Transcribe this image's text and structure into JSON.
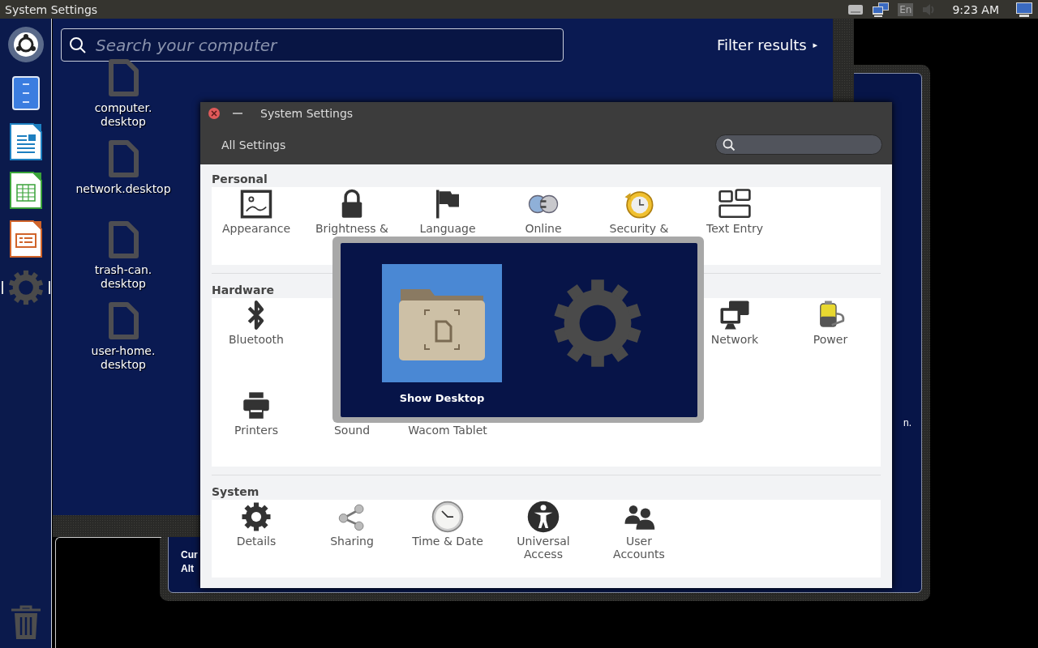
{
  "top_panel": {
    "title": "System Settings",
    "language": "En",
    "clock": "9:23 AM"
  },
  "launcher": {
    "items": [
      {
        "kind": "ubuntu",
        "running": false
      },
      {
        "kind": "files",
        "running": false
      },
      {
        "kind": "writer",
        "running": false
      },
      {
        "kind": "calc",
        "running": false
      },
      {
        "kind": "impress",
        "running": false
      },
      {
        "kind": "settings",
        "running": true
      },
      {
        "kind": "trash",
        "running": false
      }
    ]
  },
  "dash": {
    "search": {
      "placeholder": "Search your computer"
    },
    "filter": {
      "label": "Filter results",
      "arrow": "▸"
    }
  },
  "desktop_icons": [
    {
      "label": "computer. desktop"
    },
    {
      "label": "network.desktop"
    },
    {
      "label": "trash-can. desktop"
    },
    {
      "label": "user-home. desktop"
    }
  ],
  "background_window": {
    "left_texts": [
      "Cur",
      "Alt"
    ],
    "right_text": "n."
  },
  "settings_window": {
    "title": "System Settings",
    "toolbar": {
      "button": "All Settings"
    },
    "sections": [
      {
        "title": "Personal",
        "items": [
          {
            "kind": "setting",
            "label": "Appearance"
          },
          {
            "kind": "setting",
            "label": "Brightness &"
          },
          {
            "kind": "setting",
            "label": "Language"
          },
          {
            "kind": "setting",
            "label": "Online"
          },
          {
            "kind": "setting",
            "label": "Security &"
          },
          {
            "kind": "setting",
            "label": "Text Entry"
          }
        ]
      },
      {
        "title": "Hardware",
        "items": [
          {
            "kind": "setting",
            "label": "Bluetooth"
          },
          {
            "kind": "covered"
          },
          {
            "kind": "covered"
          },
          {
            "kind": "covered"
          },
          {
            "kind": "covered"
          },
          {
            "kind": "setting",
            "label": "Network"
          },
          {
            "kind": "setting",
            "label": "Power"
          },
          {
            "kind": "setting",
            "label": "Printers"
          },
          {
            "kind": "setting",
            "label": "Sound"
          },
          {
            "kind": "setting",
            "label": "Wacom Tablet"
          }
        ]
      },
      {
        "title": "System",
        "items": [
          {
            "kind": "setting",
            "label": "Details"
          },
          {
            "kind": "setting",
            "label": "Sharing"
          },
          {
            "kind": "setting",
            "label": "Time & Date"
          },
          {
            "kind": "setting",
            "label": "Universal Access"
          },
          {
            "kind": "setting",
            "label": "User Accounts"
          }
        ]
      }
    ]
  },
  "switcher": {
    "items": [
      {
        "kind": "folder",
        "label": "Show Desktop",
        "selected": true
      },
      {
        "kind": "gear",
        "selected": false
      }
    ]
  }
}
